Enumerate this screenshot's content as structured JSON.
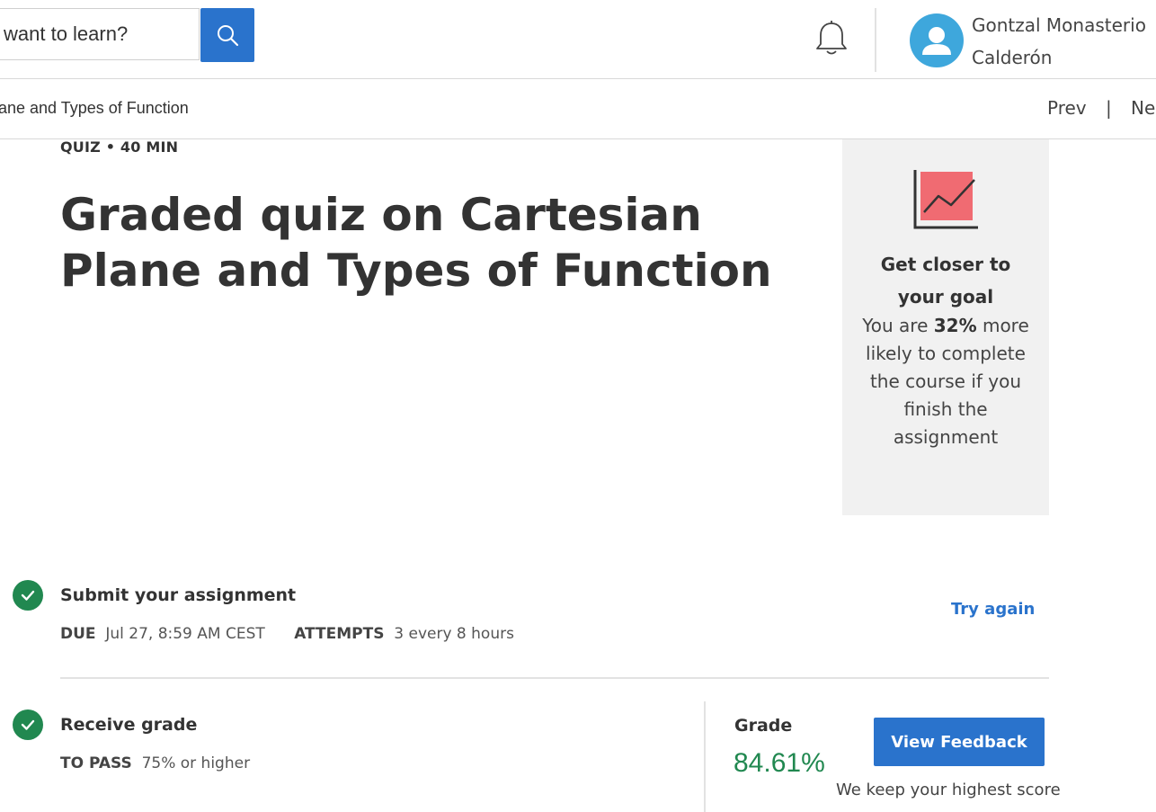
{
  "header": {
    "search": {
      "placeholder": "want to learn?",
      "icon": "search-icon"
    },
    "notifications_icon": "bell-icon",
    "user": {
      "name_line1": "Gontzal Monasterio",
      "name_line2": "Calderón",
      "avatar_icon": "user-avatar-icon"
    }
  },
  "nav": {
    "breadcrumb": "ane and Types of Function",
    "prev_label": "Prev",
    "separator": "|",
    "next_label": "Ne"
  },
  "quiz": {
    "meta": "QUIZ • 40 MIN",
    "title": "Graded quiz on Cartesian Plane and Types of Function"
  },
  "goal": {
    "icon": "trend-chart-icon",
    "heading": "Get closer to your goal",
    "text_before": "You are ",
    "percent": "32%",
    "text_after": " more likely to complete the course if you finish the assignment"
  },
  "steps": {
    "submit": {
      "title": "Submit your assignment",
      "due_label": "DUE",
      "due_value": "Jul 27, 8:59 AM CEST",
      "attempts_label": "ATTEMPTS",
      "attempts_value": "3 every 8 hours",
      "action_label": "Try again"
    },
    "grade": {
      "title": "Receive grade",
      "pass_label": "TO PASS",
      "pass_value": "75% or higher",
      "grade_label": "Grade",
      "grade_value": "84.61%",
      "feedback_button": "View Feedback",
      "note": "We keep your highest score"
    }
  },
  "colors": {
    "primary": "#2a73cc",
    "success": "#218850",
    "avatar": "#3ea7dc",
    "goal_icon_fill": "#f06b72",
    "panel_bg": "#f1f1f1"
  }
}
